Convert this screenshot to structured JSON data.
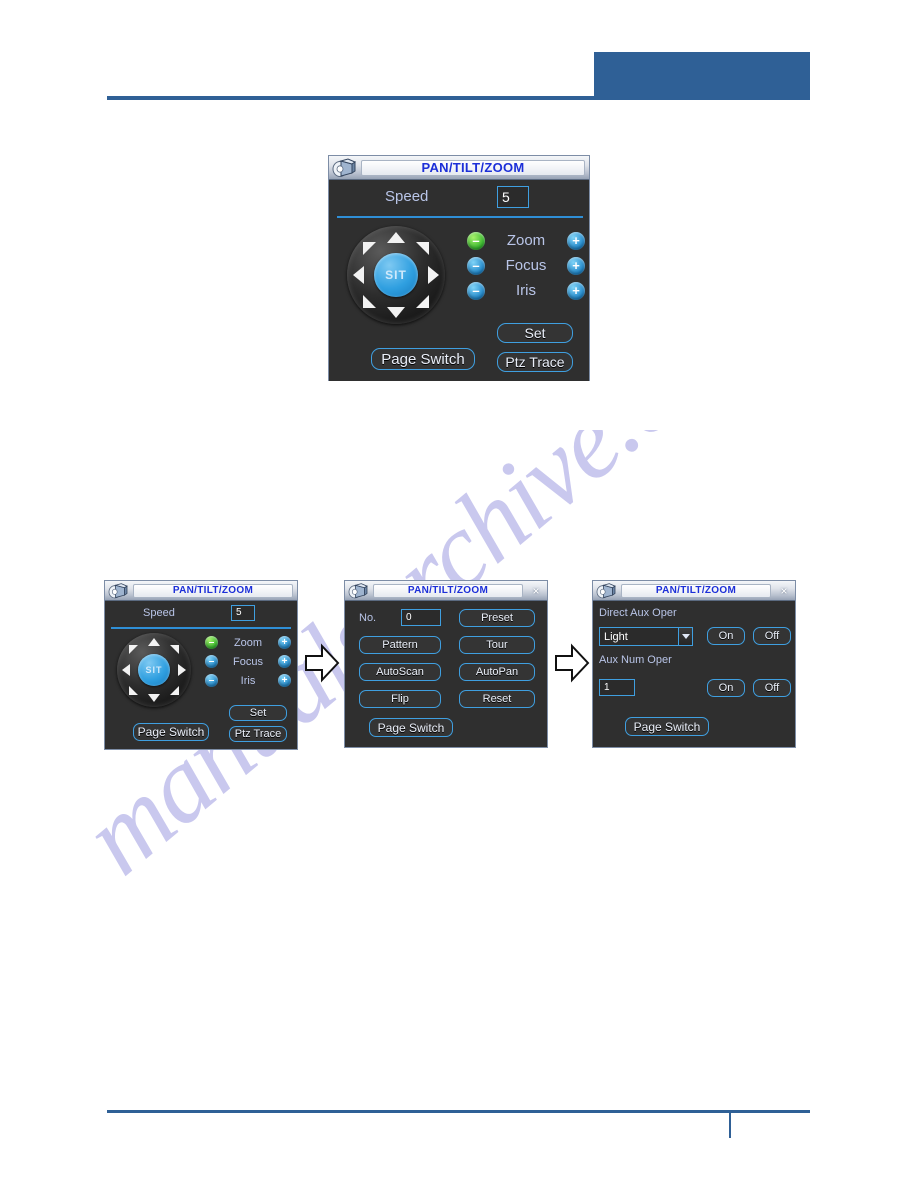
{
  "page": {
    "watermark_text": "manualsarchive.com",
    "accent_color": "#2f6096"
  },
  "header": {
    "block_label": ""
  },
  "footer": {
    "rule_label": ""
  },
  "dialog_title": "PAN/TILT/ZOOM",
  "icons": {
    "dome_camera": "dome-camera-icon",
    "close": "×",
    "minus": "–",
    "plus": "+",
    "joystick_center": "SIT"
  },
  "main_panel": {
    "title": "PAN/TILT/ZOOM",
    "speed_label": "Speed",
    "speed_value": "5",
    "center_button": "SIT",
    "controls": [
      {
        "label": "Zoom",
        "minus": "–",
        "plus": "+",
        "minus_color": "#31b52b",
        "plus_color": "#1d84c8",
        "minus_state": "green"
      },
      {
        "label": "Focus",
        "minus": "–",
        "plus": "+",
        "minus_color": "#1d84c8",
        "plus_color": "#1d84c8",
        "minus_state": "blue"
      },
      {
        "label": "Iris",
        "minus": "–",
        "plus": "+",
        "minus_color": "#1d84c8",
        "plus_color": "#1d84c8",
        "minus_state": "blue"
      }
    ],
    "set_button": "Set",
    "ptz_trace_button": "Ptz Trace",
    "page_switch_button": "Page Switch"
  },
  "flow": {
    "panel1": {
      "title": "PAN/TILT/ZOOM",
      "speed_label": "Speed",
      "speed_value": "5",
      "center_button": "SIT",
      "controls": [
        {
          "label": "Zoom",
          "minus": "–",
          "plus": "+",
          "minus_state": "green"
        },
        {
          "label": "Focus",
          "minus": "–",
          "plus": "+",
          "minus_state": "blue"
        },
        {
          "label": "Iris",
          "minus": "–",
          "plus": "+",
          "minus_state": "blue"
        }
      ],
      "set_button": "Set",
      "ptz_trace_button": "Ptz Trace",
      "page_switch_button": "Page Switch"
    },
    "panel2": {
      "title": "PAN/TILT/ZOOM",
      "no_label": "No.",
      "no_value": "0",
      "buttons": [
        {
          "label": "Preset"
        },
        {
          "label": "Pattern"
        },
        {
          "label": "Tour"
        },
        {
          "label": "AutoScan"
        },
        {
          "label": "AutoPan"
        },
        {
          "label": "Flip"
        },
        {
          "label": "Reset"
        }
      ],
      "preset_button": "Preset",
      "pattern_button": "Pattern",
      "tour_button": "Tour",
      "autoscan_button": "AutoScan",
      "autopan_button": "AutoPan",
      "flip_button": "Flip",
      "reset_button": "Reset",
      "page_switch_button": "Page Switch"
    },
    "panel3": {
      "title": "PAN/TILT/ZOOM",
      "direct_aux_label": "Direct Aux Oper",
      "aux_select_value": "Light",
      "aux_num_label": "Aux Num Oper",
      "aux_num_value": "1",
      "on_button": "On",
      "off_button": "Off",
      "page_switch_button": "Page Switch"
    }
  }
}
